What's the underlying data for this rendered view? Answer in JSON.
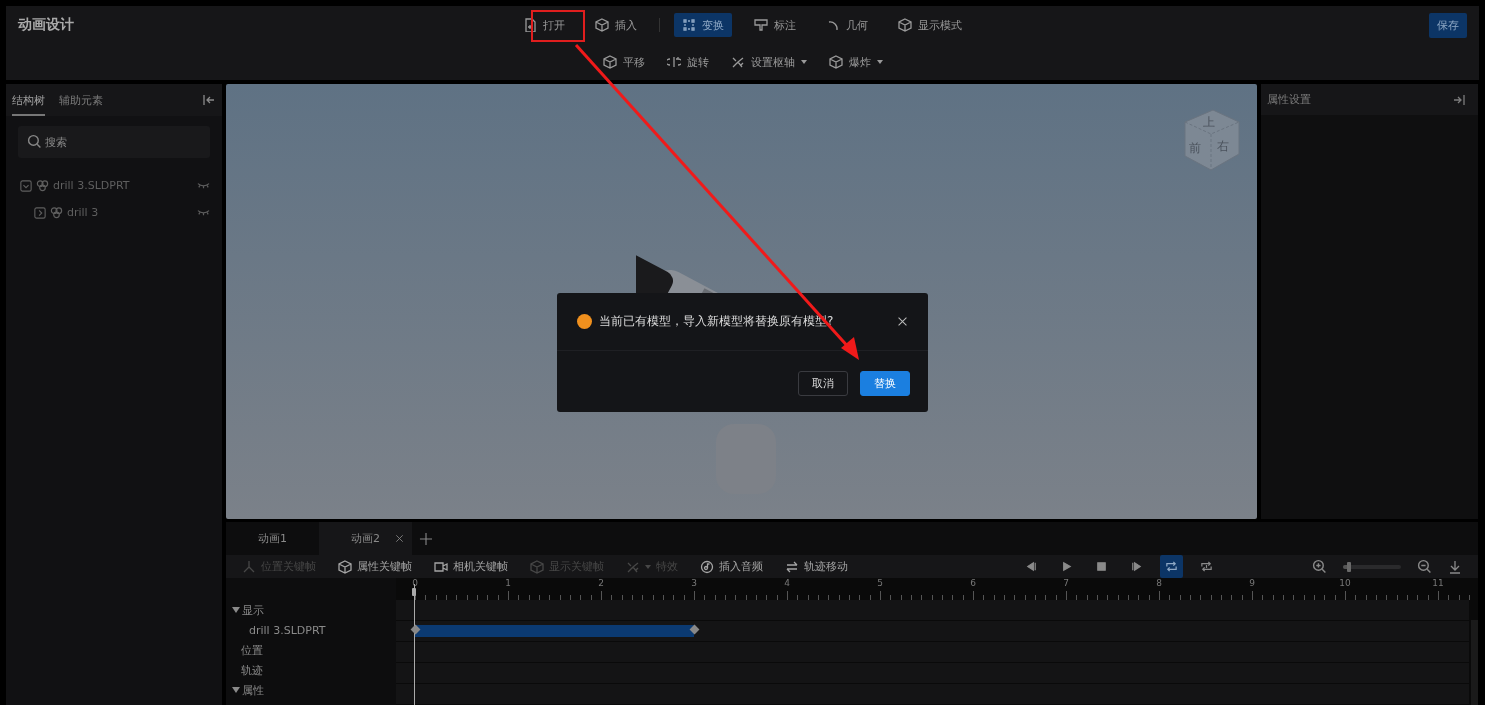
{
  "app": {
    "title": "动画设计",
    "save": "保存"
  },
  "toolbar": [
    {
      "label": "打开",
      "selected": false
    },
    {
      "label": "插入",
      "selected": false
    },
    {
      "label": "变换",
      "selected": true
    },
    {
      "label": "标注",
      "selected": false
    },
    {
      "label": "几何",
      "selected": false
    },
    {
      "label": "显示模式",
      "selected": false
    }
  ],
  "subtoolbar": [
    {
      "label": "平移",
      "dropdown": false
    },
    {
      "label": "旋转",
      "dropdown": false
    },
    {
      "label": "设置枢轴",
      "dropdown": true
    },
    {
      "label": "爆炸",
      "dropdown": true
    }
  ],
  "left_panel": {
    "tabs": [
      {
        "label": "结构树",
        "selected": true
      },
      {
        "label": "辅助元素",
        "selected": false
      }
    ],
    "search": {
      "placeholder": "搜索"
    },
    "tree": [
      {
        "label": "drill 3.SLDPRT",
        "expanded": true,
        "children": [
          {
            "label": "drill 3",
            "expanded": false
          }
        ]
      }
    ]
  },
  "viewport": {
    "view_cube": [
      "上",
      "前",
      "右"
    ]
  },
  "right_panel": {
    "title": "属性设置"
  },
  "timeline": {
    "tabs": [
      {
        "label": "动画1",
        "selected": false
      },
      {
        "label": "动画2",
        "selected": true
      }
    ],
    "tools": [
      {
        "label": "位置关键帧",
        "disabled": true
      },
      {
        "label": "属性关键帧",
        "disabled": false
      },
      {
        "label": "相机关键帧",
        "disabled": false
      },
      {
        "label": "显示关键帧",
        "disabled": true
      },
      {
        "label": "特效",
        "disabled": true
      },
      {
        "label": "插入音频",
        "disabled": false
      },
      {
        "label": "轨迹移动",
        "disabled": false
      }
    ],
    "playback": [
      {
        "selected": false
      },
      {
        "selected": false
      },
      {
        "selected": false
      },
      {
        "selected": false
      },
      {
        "selected": true
      },
      {
        "selected": false
      }
    ],
    "zoom": {
      "level": 0.1
    },
    "ruler": [
      "0",
      "1",
      "2",
      "3",
      "4",
      "5",
      "6",
      "7",
      "8",
      "9",
      "10",
      "11"
    ],
    "tracks": [
      {
        "label": "显示",
        "kind": "group",
        "expanded": true
      },
      {
        "label": "drill 3.SLDPRT",
        "kind": "clip"
      },
      {
        "label": "位置",
        "kind": "item"
      },
      {
        "label": "轨迹",
        "kind": "item"
      },
      {
        "label": "属性",
        "kind": "group",
        "expanded": true
      }
    ]
  },
  "dialog": {
    "message": "当前已有模型，导入新模型将替换原有模型?",
    "buttons": [
      {
        "label": "取消",
        "kind": "secondary"
      },
      {
        "label": "替换",
        "kind": "primary"
      }
    ]
  }
}
